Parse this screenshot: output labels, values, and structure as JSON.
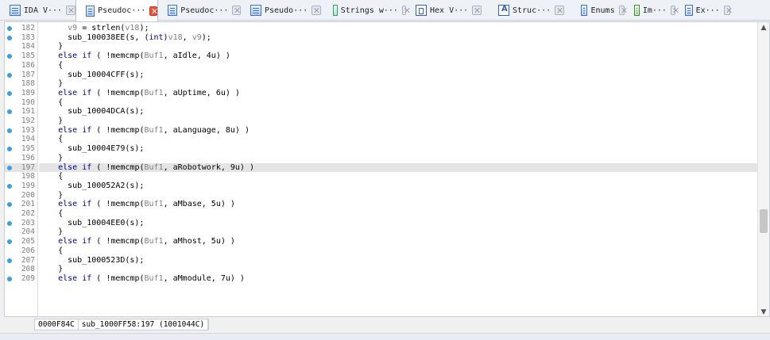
{
  "tabs": [
    {
      "label": "IDA V···",
      "icon": "pseudocode-window-icon",
      "active": false
    },
    {
      "label": "Pseudoc···",
      "icon": "pseudocode-window-icon",
      "active": true
    },
    {
      "label": "Pseudoc···",
      "icon": "pseudocode-window-icon",
      "active": false
    },
    {
      "label": "Pseudo···",
      "icon": "pseudocode-window-icon",
      "active": false
    },
    {
      "label": "Strings w···",
      "icon": "strings-window-icon",
      "active": false
    },
    {
      "label": "Hex V···",
      "icon": "hex-view-icon",
      "active": false
    },
    {
      "label": "Struc···",
      "icon": "structures-icon",
      "active": false
    },
    {
      "label": "Enums",
      "icon": "enums-icon",
      "active": false
    },
    {
      "label": "Im···",
      "icon": "imports-icon",
      "active": false
    },
    {
      "label": "Ex···",
      "icon": "exports-icon",
      "active": false
    }
  ],
  "code_lines": [
    {
      "num": "182",
      "dot": true,
      "text": "      v9 = strlen(v18);"
    },
    {
      "num": "183",
      "dot": true,
      "text": "      sub_100038EE(s, (int)v18, v9);"
    },
    {
      "num": "184",
      "dot": false,
      "text": "    }"
    },
    {
      "num": "185",
      "dot": true,
      "text": "    else if ( !memcmp(Buf1, aIdle, 4u) )"
    },
    {
      "num": "186",
      "dot": false,
      "text": "    {"
    },
    {
      "num": "187",
      "dot": true,
      "text": "      sub_10004CFF(s);"
    },
    {
      "num": "188",
      "dot": false,
      "text": "    }"
    },
    {
      "num": "189",
      "dot": true,
      "text": "    else if ( !memcmp(Buf1, aUptime, 6u) )"
    },
    {
      "num": "190",
      "dot": false,
      "text": "    {"
    },
    {
      "num": "191",
      "dot": true,
      "text": "      sub_10004DCA(s);"
    },
    {
      "num": "192",
      "dot": false,
      "text": "    }"
    },
    {
      "num": "193",
      "dot": true,
      "text": "    else if ( !memcmp(Buf1, aLanguage, 8u) )"
    },
    {
      "num": "194",
      "dot": false,
      "text": "    {"
    },
    {
      "num": "195",
      "dot": true,
      "text": "      sub_10004E79(s);"
    },
    {
      "num": "196",
      "dot": false,
      "text": "    }"
    },
    {
      "num": "197",
      "dot": true,
      "text": "    else if ( !memcmp(Buf1, aRobotwork, 9u) )",
      "highlight": true
    },
    {
      "num": "198",
      "dot": false,
      "text": "    {"
    },
    {
      "num": "199",
      "dot": true,
      "text": "      sub_100052A2(s);"
    },
    {
      "num": "200",
      "dot": false,
      "text": "    }"
    },
    {
      "num": "201",
      "dot": true,
      "text": "    else if ( !memcmp(Buf1, aMbase, 5u) )"
    },
    {
      "num": "202",
      "dot": false,
      "text": "    {"
    },
    {
      "num": "203",
      "dot": true,
      "text": "      sub_10004EE0(s);"
    },
    {
      "num": "204",
      "dot": false,
      "text": "    }"
    },
    {
      "num": "205",
      "dot": true,
      "text": "    else if ( !memcmp(Buf1, aMhost, 5u) )"
    },
    {
      "num": "206",
      "dot": false,
      "text": "    {"
    },
    {
      "num": "207",
      "dot": true,
      "text": "      sub_1000523D(s);"
    },
    {
      "num": "208",
      "dot": false,
      "text": "    }"
    },
    {
      "num": "209",
      "dot": true,
      "text": "    else if ( !memcmp(Buf1, aMmodule, 7u) )"
    }
  ],
  "status": {
    "address": "0000F84C",
    "location": "sub_1000FF58:197 (1001044C)"
  },
  "scrollbar": {
    "up_arrow": "▲",
    "down_arrow": "▼"
  },
  "colors": {
    "breakpoint_dot": "#3aa0e0",
    "keyword": "#000080",
    "variable": "#808080",
    "highlight_row": "#e4e4e4"
  }
}
